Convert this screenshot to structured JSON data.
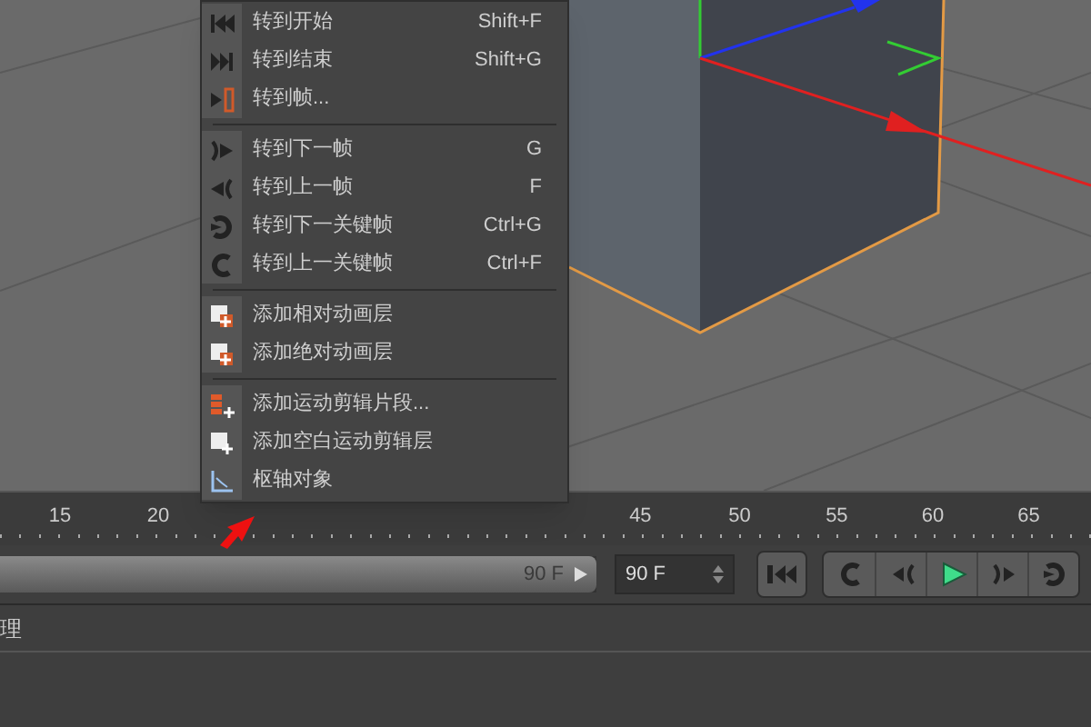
{
  "menu": {
    "sections": [
      [
        {
          "label": "转到开始",
          "shortcut": "Shift+F"
        },
        {
          "label": "转到结束",
          "shortcut": "Shift+G"
        },
        {
          "label": "转到帧..."
        }
      ],
      [
        {
          "label": "转到下一帧",
          "shortcut": "G"
        },
        {
          "label": "转到上一帧",
          "shortcut": "F"
        },
        {
          "label": "转到下一关键帧",
          "shortcut": "Ctrl+G"
        },
        {
          "label": "转到上一关键帧",
          "shortcut": "Ctrl+F"
        }
      ],
      [
        {
          "label": "添加相对动画层"
        },
        {
          "label": "添加绝对动画层"
        }
      ],
      [
        {
          "label": "添加运动剪辑片段..."
        },
        {
          "label": "添加空白运动剪辑层"
        },
        {
          "label": "枢轴对象"
        }
      ]
    ]
  },
  "ruler": {
    "ticks": [
      {
        "label": "15"
      },
      {
        "label": "20"
      },
      {
        "label": "45"
      },
      {
        "label": "50"
      },
      {
        "label": "55"
      },
      {
        "label": "60"
      },
      {
        "label": "65"
      }
    ]
  },
  "timeline": {
    "end_value": "90 F",
    "max_field": "90 F",
    "level": 1
  },
  "panel": {
    "tab_label": "理"
  }
}
